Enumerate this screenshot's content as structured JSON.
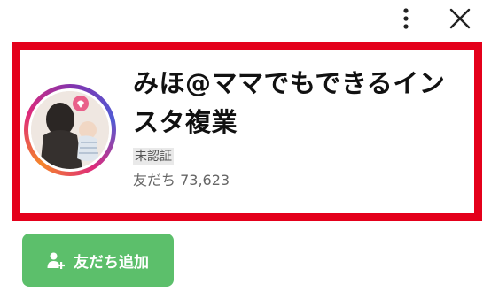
{
  "header": {
    "more_icon": "more-vertical-icon",
    "close_icon": "close-icon"
  },
  "profile": {
    "name": "みほ@ママでもできるインスタ複業",
    "status": "未認証",
    "friends_label": "友だち",
    "friends_count": "73,623"
  },
  "actions": {
    "add_friend_label": "友だち追加",
    "add_friend_icon": "add-person-icon"
  },
  "colors": {
    "highlight_border": "#e4001b",
    "add_button_bg": "#5cbf6b",
    "status_badge_bg": "#e9e9e9"
  }
}
